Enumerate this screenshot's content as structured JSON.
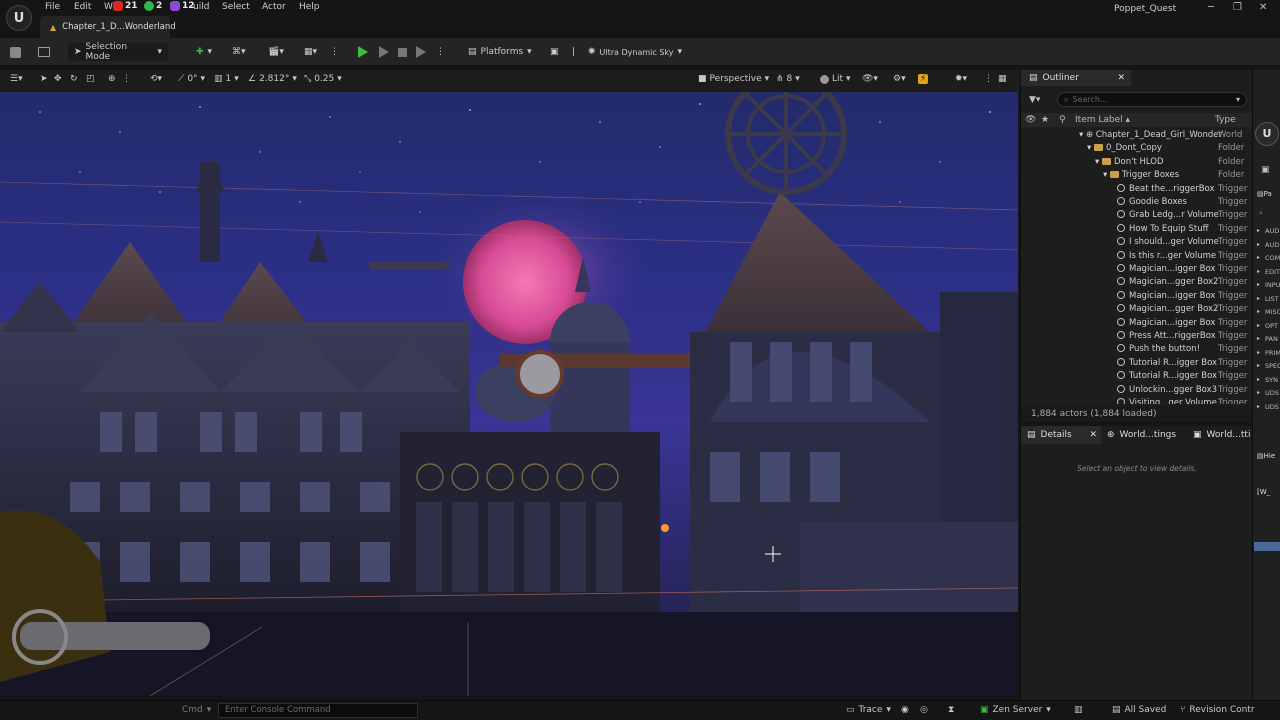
{
  "menu": {
    "items": [
      "File",
      "Edit",
      "W",
      "uild",
      "Select",
      "Actor",
      "Help"
    ],
    "badges": [
      {
        "count": "21",
        "color": "#e02424"
      },
      {
        "count": "2",
        "color": "#2fb84a"
      },
      {
        "count": "12",
        "color": "#8a4bd6"
      }
    ],
    "project_name": "Poppet_Quest",
    "level_tab": "Chapter_1_D...Wonderland"
  },
  "toolbar": {
    "selection_mode": "Selection Mode",
    "platforms": "Platforms",
    "sky_plugin": "Ultra Dynamic Sky"
  },
  "viewport_toolbar": {
    "rotation_snap": "0°",
    "grid_snap": "1",
    "angle_value": "2.812°",
    "scale_snap": "0.25",
    "perspective": "Perspective",
    "camera_speed": "8",
    "view_mode": "Lit"
  },
  "outliner": {
    "title": "Outliner",
    "search_placeholder": "Search...",
    "col_label": "Item Label ▴",
    "col_type": "Type",
    "items": [
      {
        "label": "Chapter_1_Dead_Girl_Wonder",
        "type": "World",
        "depth": 0,
        "kind": "world"
      },
      {
        "label": "0_Dont_Copy",
        "type": "Folder",
        "depth": 1,
        "kind": "folder"
      },
      {
        "label": "Don't HLOD",
        "type": "Folder",
        "depth": 2,
        "kind": "folder"
      },
      {
        "label": "Trigger Boxes",
        "type": "Folder",
        "depth": 3,
        "kind": "folder"
      },
      {
        "label": "Beat the...riggerBox",
        "type": "Trigger",
        "depth": 4,
        "kind": "trigger"
      },
      {
        "label": "Goodie Boxes",
        "type": "Trigger",
        "depth": 4,
        "kind": "trigger"
      },
      {
        "label": "Grab Ledg...r Volume",
        "type": "Trigger",
        "depth": 4,
        "kind": "trigger"
      },
      {
        "label": "How To Equip Stuff",
        "type": "Trigger",
        "depth": 4,
        "kind": "trigger"
      },
      {
        "label": "I should...ger Volume",
        "type": "Trigger",
        "depth": 4,
        "kind": "trigger"
      },
      {
        "label": "Is this r...ger Volume",
        "type": "Trigger",
        "depth": 4,
        "kind": "trigger"
      },
      {
        "label": "Magician...igger Box",
        "type": "Trigger",
        "depth": 4,
        "kind": "trigger"
      },
      {
        "label": "Magician...gger Box2",
        "type": "Trigger",
        "depth": 4,
        "kind": "trigger"
      },
      {
        "label": "Magician...igger Box",
        "type": "Trigger",
        "depth": 4,
        "kind": "trigger"
      },
      {
        "label": "Magician...gger Box2",
        "type": "Trigger",
        "depth": 4,
        "kind": "trigger"
      },
      {
        "label": "Magician...igger Box",
        "type": "Trigger",
        "depth": 4,
        "kind": "trigger"
      },
      {
        "label": "Press Att...riggerBox",
        "type": "Trigger",
        "depth": 4,
        "kind": "trigger"
      },
      {
        "label": "Push the button!",
        "type": "Trigger",
        "depth": 4,
        "kind": "trigger"
      },
      {
        "label": "Tutorial R...igger Box",
        "type": "Trigger",
        "depth": 4,
        "kind": "trigger"
      },
      {
        "label": "Tutorial R...igger Box",
        "type": "Trigger",
        "depth": 4,
        "kind": "trigger"
      },
      {
        "label": "Unlockin...gger Box3",
        "type": "Trigger",
        "depth": 4,
        "kind": "trigger"
      },
      {
        "label": "Visiting...ger Volume",
        "type": "Trigger",
        "depth": 4,
        "kind": "trigger"
      }
    ],
    "actor_count": "1,884 actors (1,884 loaded)"
  },
  "details": {
    "tabs": [
      "Details",
      "World...tings",
      "World...tti"
    ],
    "empty_message": "Select an object to view details."
  },
  "right_panel": {
    "header": "Pa",
    "items": [
      "AUD",
      "AUD",
      "COM",
      "EDIT",
      "INPU",
      "LIST",
      "MISC",
      "OPT",
      "PAN",
      "PRIM",
      "SPEC",
      "SYN",
      "UDS",
      "UDS"
    ],
    "lower_header": "Hie",
    "lower_item": "[W_"
  },
  "statusbar": {
    "cmd_label": "Cmd",
    "console_placeholder": "Enter Console Command",
    "trace": "Trace",
    "zen_server": "Zen Server",
    "all_saved": "All Saved",
    "revision_control": "Revision Contr"
  },
  "colors": {
    "accent_play": "#3dbb3d",
    "moon": "#e060a0",
    "sky": "#2b2f85",
    "folder": "#c9a14a"
  }
}
